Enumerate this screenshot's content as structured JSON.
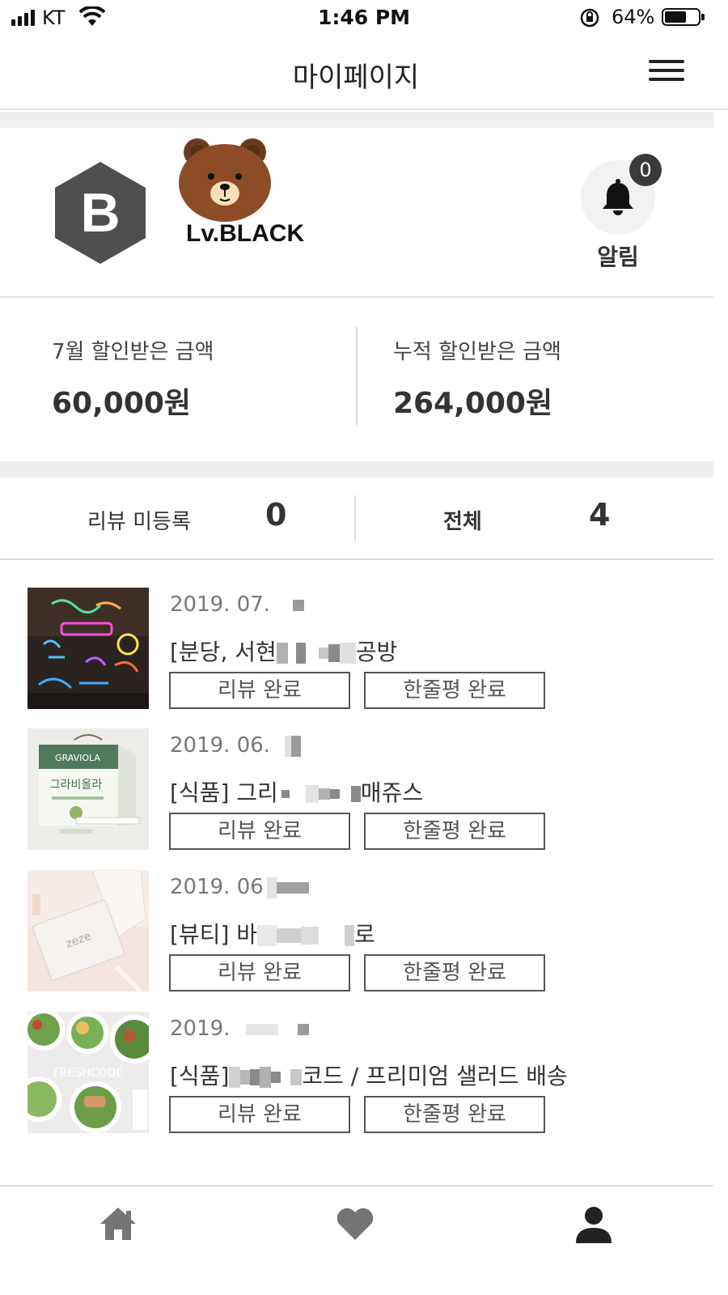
{
  "status_bar": {
    "carrier": "KT",
    "time": "1:46 PM",
    "battery_percent": "64%",
    "battery_level": 0.64
  },
  "header": {
    "title": "마이페이지",
    "menu_icon": "hamburger-menu-icon"
  },
  "profile": {
    "grade_letter": "B",
    "level": "Lv.BLACK",
    "notification_count": "0",
    "notification_label": "알림"
  },
  "discount": {
    "monthly_label": "7월 할인받은 금액",
    "monthly_value": "60,000원",
    "total_label": "누적 할인받은 금액",
    "total_value": "264,000원"
  },
  "review_summary": {
    "unregistered_label": "리뷰 미등록",
    "unregistered_count": "0",
    "all_label": "전체",
    "all_count": "4"
  },
  "orders": [
    {
      "date": "2019. 07.",
      "name_start": "[분당, 서현",
      "name_end": "공방",
      "review_button": "리뷰 완료",
      "oneline_button": "한줄평 완료"
    },
    {
      "date": "2019. 06.",
      "name_start": "[식품] 그리",
      "name_end": "매쥬스",
      "review_button": "리뷰 완료",
      "oneline_button": "한줄평 완료"
    },
    {
      "date": "2019. 06",
      "name_start": "[뷰티] 바",
      "name_end": "로",
      "review_button": "리뷰 완료",
      "oneline_button": "한줄평 완료"
    },
    {
      "date": "2019.",
      "name_start": "[식품]",
      "name_end": "코드 / 프리미엄 샐러드 배송",
      "review_button": "리뷰 완료",
      "oneline_button": "한줄평 완료"
    }
  ],
  "bottom_nav": {
    "items": [
      "home-icon",
      "heart-icon",
      "person-icon"
    ]
  },
  "thumbnails": {
    "thumb2_text": "그라비올라",
    "thumb2_brand": "GRAVIOLA",
    "thumb3_text": "zeze",
    "thumb4_text": "FRESHCODE"
  }
}
